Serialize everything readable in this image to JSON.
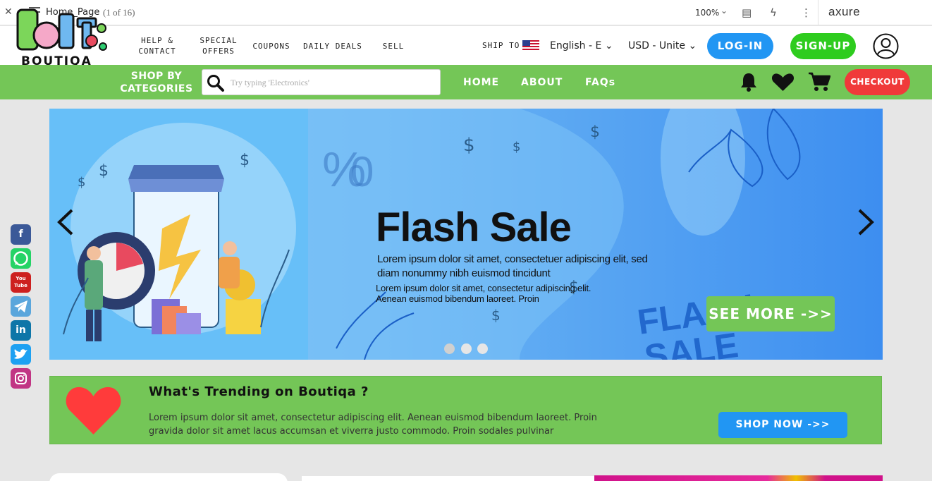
{
  "axure": {
    "page_name": "Home_Page",
    "page_count": "(1 of 16)",
    "zoom": "100%",
    "brand": "axure"
  },
  "header": {
    "logo_word": "BOUTi",
    "logo_sub": "BOUTIQA",
    "nav_small": [
      "HELP & CONTACT",
      "SPECIAL OFFERS",
      "COUPONS",
      "DAILY DEALS",
      "SELL"
    ],
    "ship_to": "SHIP TO",
    "language": "English - E",
    "currency": "USD - Unite",
    "login": "LOG-IN",
    "signup": "SIGN-UP"
  },
  "navbar": {
    "shop_by": "SHOP BY CATEGORIES",
    "search_placeholder": "Try typing 'Electronics'",
    "links": [
      "HOME",
      "ABOUT",
      "FAQs"
    ],
    "checkout": "CHECKOUT"
  },
  "social": [
    "facebook-icon",
    "whatsapp-icon",
    "youtube-icon",
    "telegram-icon",
    "linkedin-icon",
    "twitter-icon",
    "instagram-icon"
  ],
  "social_labels": {
    "facebook": "f",
    "youtube": "You Tube",
    "linkedin": "in"
  },
  "hero": {
    "title": "Flash Sale",
    "subtitle": "Lorem ipsum dolor sit amet, consectetuer adipiscing elit, sed diam nonummy nibh euismod tincidunt",
    "body": "Lorem ipsum dolor sit amet, consectetur adipiscing elit. Aenean euismod bibendum laoreet. Proin",
    "cta": "SEE MORE ->>",
    "slides": 3,
    "active_slide": 1
  },
  "trending": {
    "title": "What's Trending on Boutiqa ?",
    "text": "Lorem ipsum dolor sit amet, consectetur adipiscing elit. Aenean euismod bibendum laoreet. Proin gravida dolor sit amet lacus accumsan et viverra justo commodo. Proin sodales pulvinar",
    "cta": "SHOP NOW ->>"
  },
  "colors": {
    "green": "#74c657",
    "blue": "#2196f3",
    "red": "#f03a3a",
    "signup_green": "#2ecc1e"
  }
}
